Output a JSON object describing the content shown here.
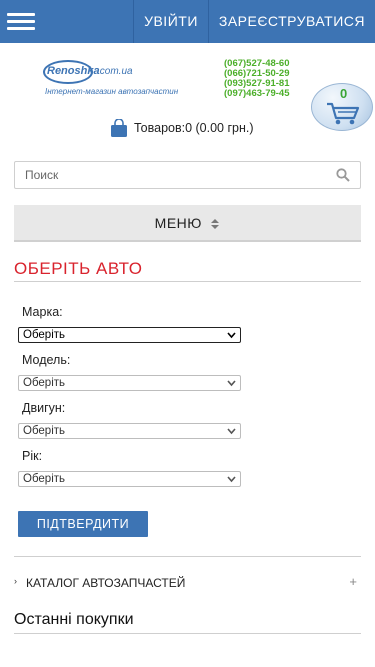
{
  "header": {
    "login_label": "УВІЙТИ",
    "register_label": "ЗАРЕЄСТРУВАТИСЯ",
    "bg_color": "#3d74b4"
  },
  "logo": {
    "name": "Renoshka",
    "domain": ".com.ua",
    "tagline": "Інтернет-магазин автозапчастин"
  },
  "phones": [
    "(067)527-48-60",
    "(066)721-50-29",
    "(093)527-91-81",
    "(097)463-79-45"
  ],
  "cart": {
    "count": "0"
  },
  "summary": {
    "text": "Товаров:0 (0.00 грн.)"
  },
  "search": {
    "placeholder": "Поиск",
    "value": ""
  },
  "menu": {
    "label": "МЕНЮ"
  },
  "choose_car": {
    "title": "ОБЕРІТЬ АВТО",
    "title_color": "#d9232d",
    "fields": [
      {
        "label": "Марка:",
        "selected": "Оберіть"
      },
      {
        "label": "Модель:",
        "selected": "Оберіть"
      },
      {
        "label": "Двигун:",
        "selected": "Оберіть"
      },
      {
        "label": "Рік:",
        "selected": "Оберіть"
      }
    ],
    "confirm_label": "ПІДТВЕРДИТИ"
  },
  "catalog": {
    "label": "КАТАЛОГ АВТОЗАПЧАСТЕЙ",
    "caret": "›",
    "plus": "+"
  },
  "recent": {
    "title": "Останні покупки"
  }
}
